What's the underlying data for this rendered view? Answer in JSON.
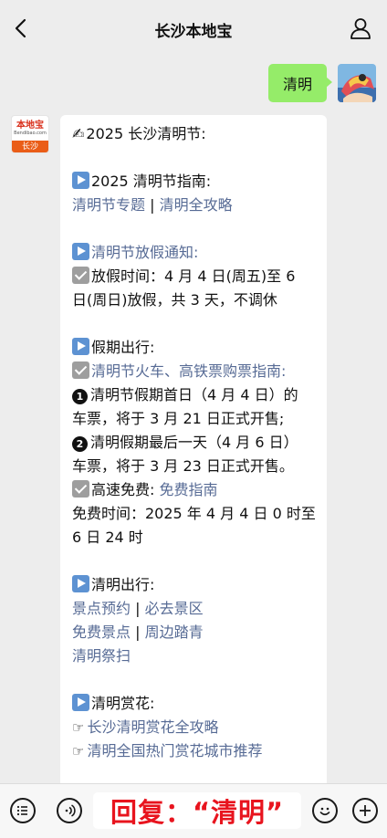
{
  "header": {
    "title": "长沙本地宝"
  },
  "user_message": {
    "text": "清明"
  },
  "bot_avatar": {
    "name": "本地宝",
    "site": "Bendibao.com",
    "city": "长沙"
  },
  "message": {
    "heading": "2025 长沙清明节:",
    "guide_title": "2025 清明节指南:",
    "guide_links": [
      "清明节专题",
      "清明全攻略"
    ],
    "holiday_title": "清明节放假通知:",
    "holiday_line1": "放假时间：4 月 4 日(周五)至 6",
    "holiday_line2": "日(周日)放假，共 3 天，不调休",
    "travel_title": "假期出行:",
    "ticket_title": "清明节火车、高铁票购票指南:",
    "ticket1_num": "1",
    "ticket1_line1": "清明节假期首日（4 月 4 日）的",
    "ticket1_line2": "车票，将于 3 月 21 日正式开售;",
    "ticket2_num": "2",
    "ticket2_line1": "清明假期最后一天（4 月 6 日）",
    "ticket2_line2": "车票，将于 3 月 23 日正式开售。",
    "highway_label": "高速免费:",
    "highway_link": "免费指南",
    "free_time_line1": "免费时间：2025 年 4 月 4 日 0 时至",
    "free_time_line2": "6 日 24 时",
    "outing_title": "清明出行:",
    "outing_row1": [
      "景点预约",
      "必去景区"
    ],
    "outing_row2": [
      "免费景点",
      "周边踏青"
    ],
    "outing_row3": "清明祭扫",
    "flower_title": "清明赏花:",
    "flower_links": [
      "长沙清明赏花全攻略",
      "清明全国热门赏花城市推荐"
    ],
    "separator": "|"
  },
  "input": {
    "text": "回复：“清明”"
  },
  "icons": {
    "back": "chevron-left-icon",
    "profile": "person-icon",
    "menu": "list-icon",
    "voice": "voice-icon",
    "emoji": "smiley-icon",
    "plus": "plus-icon",
    "play": "play-emoji-icon",
    "check": "check-emoji-icon",
    "hand": "pointing-hand-icon",
    "write": "writing-hand-icon"
  },
  "colors": {
    "background": "#ededed",
    "user_bubble": "#95ec69",
    "link": "#576b95",
    "input_text": "#e8141e",
    "play_icon": "#5d92d2",
    "check_icon": "#9e9e9e"
  }
}
